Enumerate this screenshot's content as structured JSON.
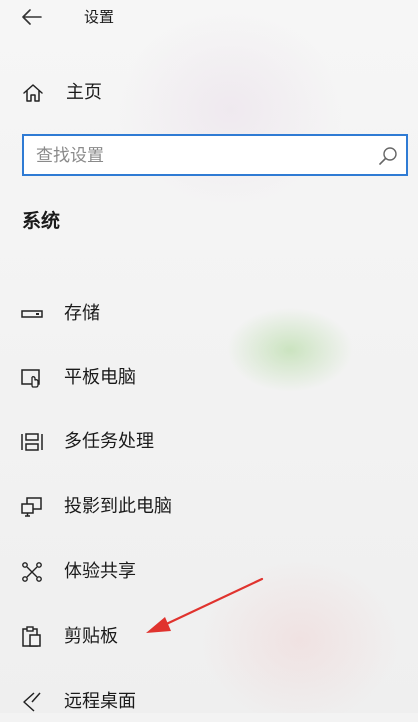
{
  "header": {
    "back_icon": "back-arrow-icon",
    "title": "设置"
  },
  "home": {
    "icon": "home-icon",
    "label": "主页"
  },
  "search": {
    "placeholder": "查找设置",
    "icon": "search-icon"
  },
  "section": {
    "title": "系统"
  },
  "nav": {
    "items": [
      {
        "label": "存储",
        "icon": "storage-icon"
      },
      {
        "label": "平板电脑",
        "icon": "tablet-icon"
      },
      {
        "label": "多任务处理",
        "icon": "multitasking-icon"
      },
      {
        "label": "投影到此电脑",
        "icon": "projecting-icon"
      },
      {
        "label": "体验共享",
        "icon": "shared-experiences-icon"
      },
      {
        "label": "剪贴板",
        "icon": "clipboard-icon"
      },
      {
        "label": "远程桌面",
        "icon": "remote-desktop-icon"
      }
    ]
  },
  "colors": {
    "accent": "#2f7bd4",
    "annotation_arrow": "#e0332e"
  }
}
